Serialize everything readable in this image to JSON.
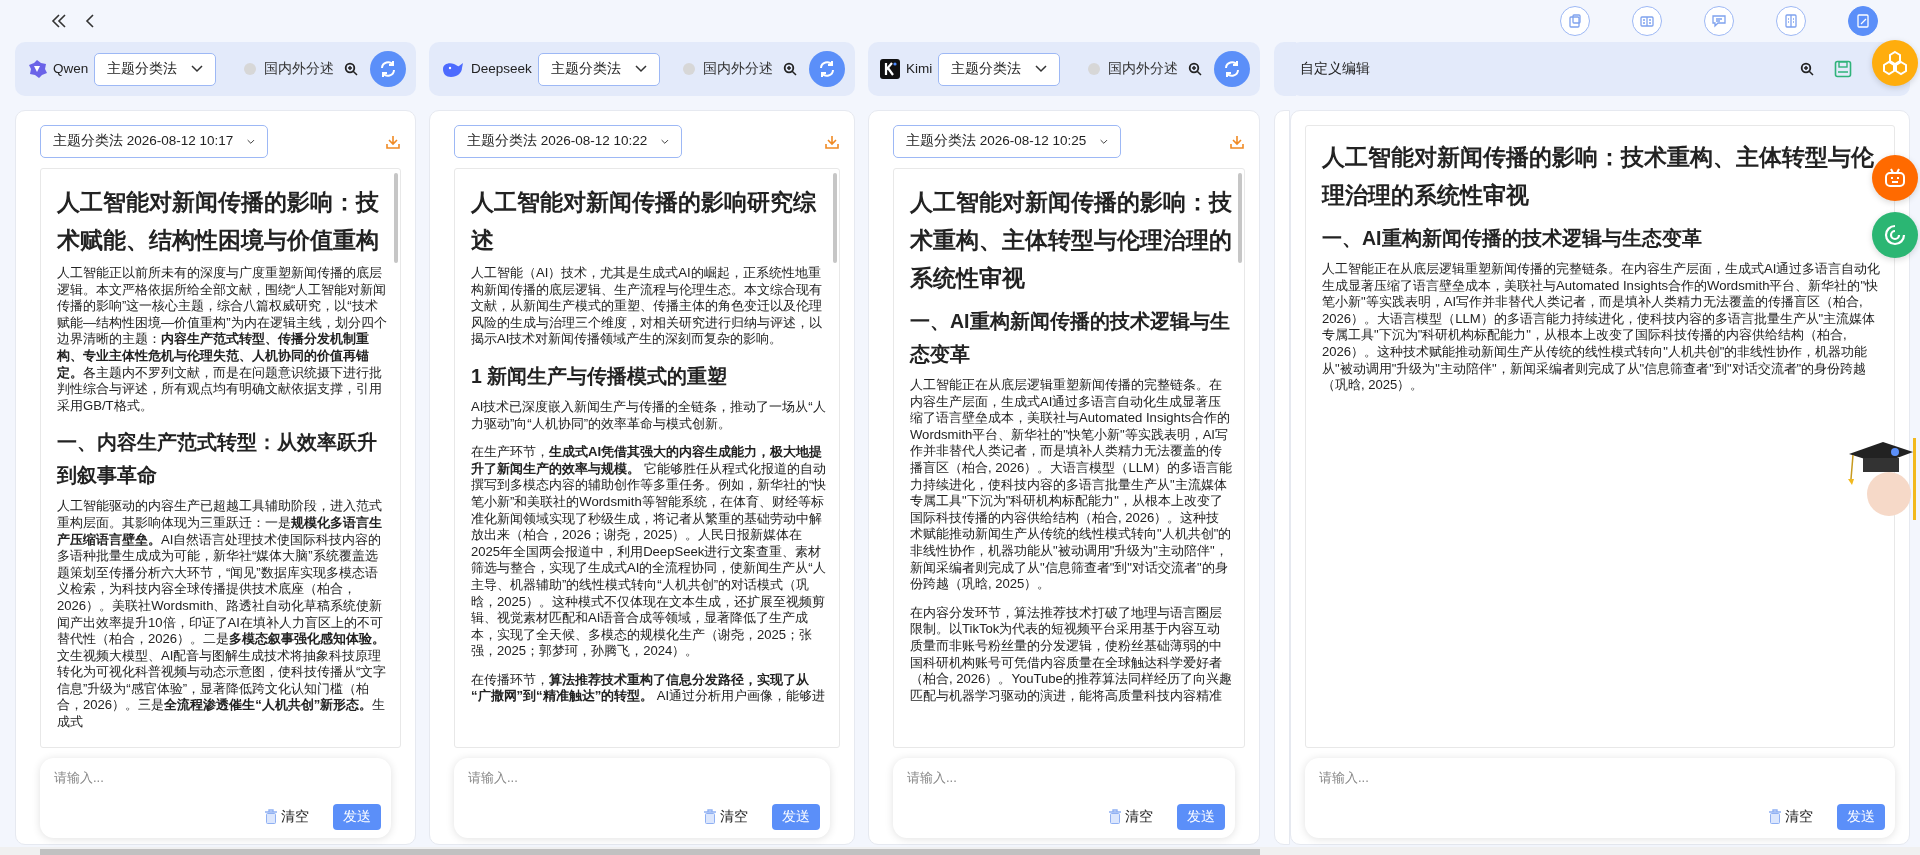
{
  "nav": [
    {
      "kind": "double-left"
    },
    {
      "kind": "left"
    }
  ],
  "toolbar": [
    {
      "kind": "documents",
      "selected": false
    },
    {
      "kind": "book",
      "selected": false
    },
    {
      "kind": "chat",
      "selected": false
    },
    {
      "kind": "compare",
      "selected": false
    },
    {
      "kind": "edit",
      "selected": true
    }
  ],
  "panels": [
    {
      "kind": "qwen",
      "model": "Qwen",
      "method": "主题分类法",
      "option": {
        "label": "国内外分述",
        "on": false
      },
      "history": "主题分类法 2026-08-12 10:17",
      "document": [
        {
          "kind": "h1",
          "text": "人工智能对新闻传播的影响：技术赋能、结构性困境与价值重构"
        },
        {
          "kind": "p",
          "text": "人工智能正以前所未有的深度与广度重塑新闻传播的底层逻辑。本文严格依据所给全部文献，围绕“人工智能对新闻传播的影响”这一核心主题，综合八篇权威研究，以“技术赋能—结构性困境—价值重构”为内在逻辑主线，划分四个边界清晰的主题：**内容生产范式转型、传播分发机制重构、专业主体性危机与伦理失范、人机协同的价值再锚定。**各主题内不罗列文献，而是在问题意识统摄下进行批判性综合与评述，所有观点均有明确文献依据支撑，引用采用GB/T格式。"
        },
        {
          "kind": "h2",
          "text": "一、内容生产范式转型：从效率跃升到叙事革命"
        },
        {
          "kind": "p",
          "text": "人工智能驱动的内容生产已超越工具辅助阶段，进入范式重构层面。其影响体现为三重跃迁：一是**规模化多语言生产压缩语言壁垒。**AI自然语言处理技术使国际科技内容的多语种批量生成成为可能，新华社“媒体大脑”系统覆盖选题策划至传播分析六大环节，“闻见”数据库实现多模态语义检索，为科技内容全球传播提供技术底座（柏合，2026）。美联社Wordsmith、路透社自动化草稿系统使新闻产出效率提升10倍，印证了AI在填补人力盲区上的不可替代性（柏合，2026）。二是**多模态叙事强化感知体验。**文生视频大模型、AI配音与图解生成技术将抽象科技原理转化为可视化科普视频与动态示意图，使科技传播从“文字信息”升级为“感官体验”，显著降低跨文化认知门槛（柏合，2026）。三是**全流程渗透催生“人机共创”新形态。**生成式"
        }
      ],
      "input": {
        "placeholder": "请输入...",
        "clear": "清空",
        "send": "发送"
      }
    },
    {
      "kind": "deepseek",
      "model": "Deepseek",
      "method": "主题分类法",
      "option": {
        "label": "国内外分述",
        "on": false
      },
      "history": "主题分类法 2026-08-12 10:22",
      "document": [
        {
          "kind": "h1",
          "text": "人工智能对新闻传播的影响研究综述"
        },
        {
          "kind": "p",
          "text": "人工智能（AI）技术，尤其是生成式AI的崛起，正系统性地重构新闻传播的底层逻辑、生产流程与伦理生态。本文综合现有文献，从新闻生产模式的重塑、传播主体的角色变迁以及伦理风险的生成与治理三个维度，对相关研究进行归纳与评述，以揭示AI技术对新闻传播领域产生的深刻而复杂的影响。"
        },
        {
          "kind": "h2",
          "text": "1 新闻生产与传播模式的重塑"
        },
        {
          "kind": "p",
          "text": "AI技术已深度嵌入新闻生产与传播的全链条，推动了一场从“人力驱动”向“人机协同”的效率革命与模式创新。"
        },
        {
          "kind": "p",
          "text": "在生产环节，**生成式AI凭借其强大的内容生成能力，极大地提升了新闻生产的效率与规模。** 它能够胜任从程式化报道的自动撰写到多模态内容的辅助创作等多重任务。例如，新华社的“快笔小新”和美联社的Wordsmith等智能系统，在体育、财经等标准化新闻领域实现了秒级生成，将记者从繁重的基础劳动中解放出来（柏合，2026；谢尧，2025）。人民日报新媒体在2025年全国两会报道中，利用DeepSeek进行文案查重、素材筛选与整合，实现了生成式AI的全流程协同，使新闻生产从“人主导、机器辅助”的线性模式转向“人机共创”的对话模式（巩晗，2025）。这种模式不仅体现在文本生成，还扩展至视频剪辑、视觉素材匹配和AI语音合成等领域，显著降低了生产成本，实现了全天候、多模态的规模化生产（谢尧，2025；张强，2025；郭梦珂，孙腾飞，2024）。"
        },
        {
          "kind": "p",
          "text": "在传播环节，**算法推荐技术重构了信息分发路径，实现了从“广撒网”到“精准触达”的转型。** AI通过分析用户画像，能够进"
        }
      ],
      "input": {
        "placeholder": "请输入...",
        "clear": "清空",
        "send": "发送"
      }
    },
    {
      "kind": "kimi",
      "model": "Kimi",
      "method": "主题分类法",
      "option": {
        "label": "国内外分述",
        "on": false
      },
      "history": "主题分类法 2026-08-12 10:25",
      "document": [
        {
          "kind": "h1",
          "text": "人工智能对新闻传播的影响：技术重构、主体转型与伦理治理的系统性审视"
        },
        {
          "kind": "h2",
          "text": "一、AI重构新闻传播的技术逻辑与生态变革"
        },
        {
          "kind": "p",
          "text": "人工智能正在从底层逻辑重塑新闻传播的完整链条。在内容生产层面，生成式AI通过多语言自动化生成显著压缩了语言壁垒成本，美联社与Automated Insights合作的Wordsmith平台、新华社的\"快笔小新\"等实践表明，AI写作并非替代人类记者，而是填补人类精力无法覆盖的传播盲区（柏合, 2026）。大语言模型（LLM）的多语言能力持续进化，使科技内容的多语言批量生产从\"主流媒体专属工具\"下沉为\"科研机构标配能力\"，从根本上改变了国际科技传播的内容供给结构（柏合, 2026）。这种技术赋能推动新闻生产从传统的线性模式转向\"人机共创\"的非线性协作，机器功能从\"被动调用\"升级为\"主动陪伴\"，新闻采编者则完成了从\"信息筛查者\"到\"对话交流者\"的身份跨越（巩晗, 2025）。"
        },
        {
          "kind": "p",
          "text": "在内容分发环节，算法推荐技术打破了地理与语言圈层限制。以TikTok为代表的短视频平台采用基于内容互动质量而非账号粉丝量的分发逻辑，使粉丝基础薄弱的中国科研机构账号可凭借内容质量在全球触达科学爱好者（柏合, 2026）。YouTube的推荐算法同样经历了向兴趣匹配与机器学习驱动的演进，能将高质量科技内容精准"
        }
      ],
      "input": {
        "placeholder": "请输入...",
        "clear": "清空",
        "send": "发送"
      }
    }
  ],
  "custom_panel": {
    "title": "自定义编辑",
    "document": [
      {
        "kind": "h1",
        "text": "人工智能对新闻传播的影响：技术重构、主体转型与伦理治理的系统性审视"
      },
      {
        "kind": "h2",
        "text": "一、AI重构新闻传播的技术逻辑与生态变革"
      },
      {
        "kind": "p",
        "text": "人工智能正在从底层逻辑重塑新闻传播的完整链条。在内容生产层面，生成式AI通过多语言自动化生成显著压缩了语言壁垒成本，美联社与Automated Insights合作的Wordsmith平台、新华社的\"快笔小新\"等实践表明，AI写作并非替代人类记者，而是填补人类精力无法覆盖的传播盲区（柏合, 2026）。大语言模型（LLM）的多语言能力持续进化，使科技内容的多语言批量生产从\"主流媒体专属工具\"下沉为\"科研机构标配能力\"，从根本上改变了国际科技传播的内容供给结构（柏合, 2026）。这种技术赋能推动新闻生产从传统的线性模式转向\"人机共创\"的非线性协作，机器功能从\"被动调用\"升级为\"主动陪伴\"，新闻采编者则完成了从\"信息筛查者\"到\"对话交流者\"的身份跨越（巩晗, 2025）。"
      }
    ],
    "input": {
      "placeholder": "请输入...",
      "clear": "清空",
      "send": "发送"
    }
  }
}
